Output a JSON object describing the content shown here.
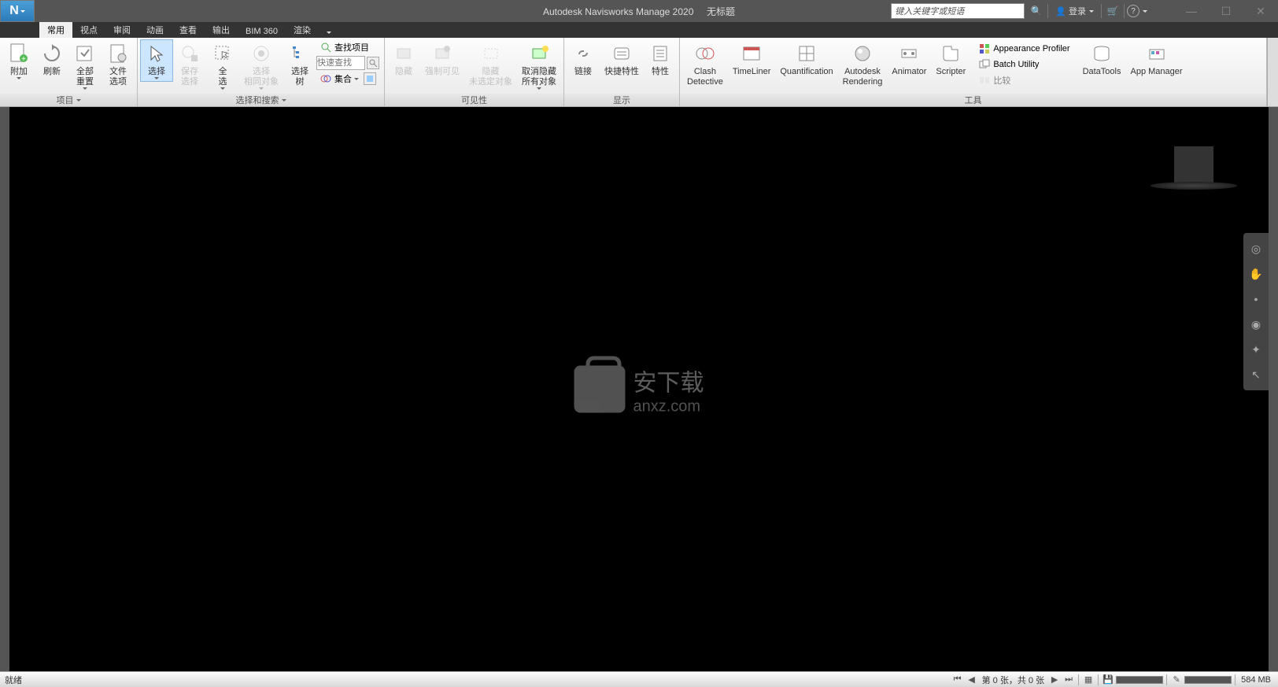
{
  "title": {
    "app": "Autodesk Navisworks Manage 2020",
    "doc": "无标题"
  },
  "search": {
    "placeholder": "键入关键字或短语"
  },
  "login": {
    "label": "登录"
  },
  "tabs": [
    "常用",
    "视点",
    "审阅",
    "动画",
    "查看",
    "输出",
    "BIM 360",
    "渲染"
  ],
  "ribbon": {
    "group_project": {
      "title": "项目",
      "items": {
        "append": "附加",
        "refresh": "刷新",
        "reset_all": "全部\n重置",
        "file_opts": "文件\n选项"
      }
    },
    "group_select": {
      "title": "选择和搜索",
      "items": {
        "select": "选择",
        "save_sel": "保存\n选择",
        "select_all": "全\n选",
        "select_same": "选择\n相同对象",
        "tree": "选择\n树",
        "find": "查找项目",
        "quick_find": "快速查找",
        "sets": "集合"
      }
    },
    "group_vis": {
      "title": "可见性",
      "items": {
        "hide": "隐藏",
        "force_vis": "强制可见",
        "hide_unsel": "隐藏\n未选定对象",
        "unhide_all": "取消隐藏\n所有对象"
      }
    },
    "group_display": {
      "title": "显示",
      "items": {
        "links": "链接",
        "quick_props": "快捷特性",
        "props": "特性"
      }
    },
    "group_tools": {
      "title": "工具",
      "items": {
        "clash": "Clash\nDetective",
        "timeliner": "TimeLiner",
        "quant": "Quantification",
        "render": "Autodesk\nRendering",
        "animator": "Animator",
        "scripter": "Scripter",
        "appearance": "Appearance Profiler",
        "batch": "Batch Utility",
        "compare": "比较",
        "datatools": "DataTools",
        "appmgr": "App Manager"
      }
    }
  },
  "watermark": {
    "text": "安下载",
    "sub": "anxz.com"
  },
  "status": {
    "ready": "就绪",
    "sheets": "第 0 张，共 0 张",
    "mem": "584 MB"
  }
}
